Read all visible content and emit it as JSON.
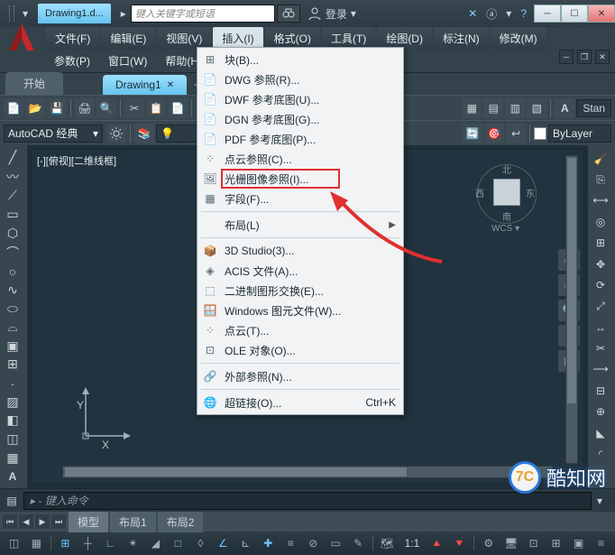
{
  "title": {
    "file_tab": "Drawing1.d..."
  },
  "search": {
    "placeholder": "键入关键字或短语"
  },
  "login": {
    "label": "登录"
  },
  "menubar": {
    "top": [
      "文件(F)",
      "编辑(E)",
      "视图(V)",
      "插入(I)",
      "格式(O)",
      "工具(T)",
      "绘图(D)",
      "标注(N)",
      "修改(M)"
    ],
    "second": [
      "参数(P)",
      "窗口(W)",
      "帮助(H)"
    ]
  },
  "tabstrip": {
    "start": "开始",
    "doc": "Drawing1",
    "plus": "+"
  },
  "workspace": {
    "label": "AutoCAD 经典"
  },
  "layer": {
    "combo_text": " "
  },
  "style": {
    "text_style": "A",
    "chip": "Stan"
  },
  "bylayer": "ByLayer",
  "viewport_label": "[-][俯视][二维线框]",
  "viewcube": {
    "n": "北",
    "s": "南",
    "e": "东",
    "w": "西",
    "wcs": "WCS ▾"
  },
  "ucs": {
    "x": "X",
    "y": "Y"
  },
  "dropdown": {
    "items": [
      {
        "icon": "block",
        "label": "块(B)..."
      },
      {
        "icon": "dwg",
        "label": "DWG 参照(R)..."
      },
      {
        "icon": "dwf",
        "label": "DWF 参考底图(U)..."
      },
      {
        "icon": "dgn",
        "label": "DGN 参考底图(G)..."
      },
      {
        "icon": "pdf",
        "label": "PDF 参考底图(P)..."
      },
      {
        "icon": "pointcloud",
        "label": "点云参照(C)..."
      },
      {
        "icon": "raster",
        "label": "光栅图像参照(I)...",
        "highlight": true
      },
      {
        "icon": "field",
        "label": "字段(F)..."
      },
      {
        "sep": true
      },
      {
        "icon": "",
        "label": "布局(L)",
        "arrow": true
      },
      {
        "sep": true
      },
      {
        "icon": "3ds",
        "label": "3D Studio(3)..."
      },
      {
        "icon": "acis",
        "label": "ACIS 文件(A)..."
      },
      {
        "icon": "binary",
        "label": "二进制图形交换(E)..."
      },
      {
        "icon": "wmf",
        "label": "Windows 图元文件(W)..."
      },
      {
        "icon": "pointcloud2",
        "label": "点云(T)..."
      },
      {
        "icon": "ole",
        "label": "OLE 对象(O)..."
      },
      {
        "sep": true
      },
      {
        "icon": "xref",
        "label": "外部参照(N)..."
      },
      {
        "sep": true
      },
      {
        "icon": "hyperlink",
        "label": "超链接(O)...",
        "shortcut": "Ctrl+K"
      }
    ]
  },
  "cmdline": {
    "placeholder": "▸ - 键入命令"
  },
  "layout_tabs": {
    "model": "模型",
    "l1": "布局1",
    "l2": "布局2"
  },
  "status": {
    "scale": "1:1",
    "ann": "▾"
  },
  "watermark": {
    "logo": "7C",
    "site": "酷知网"
  }
}
